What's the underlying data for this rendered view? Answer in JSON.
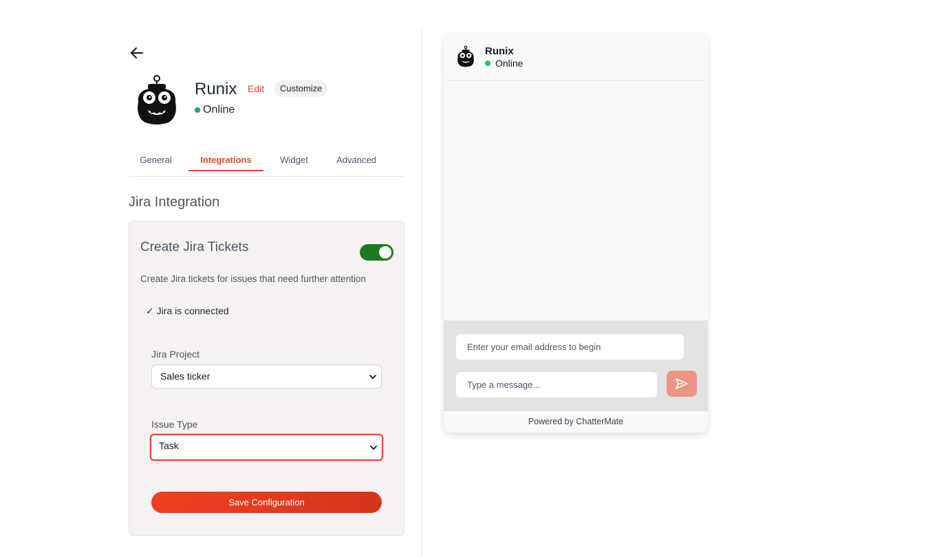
{
  "agent": {
    "name": "Runix",
    "edit_label": "Edit",
    "customize_label": "Customize",
    "status": "Online"
  },
  "tabs": [
    {
      "label": "General",
      "active": false
    },
    {
      "label": "Integrations",
      "active": true
    },
    {
      "label": "Widget",
      "active": false
    },
    {
      "label": "Advanced",
      "active": false
    }
  ],
  "section_title": "Jira Integration",
  "jira": {
    "card_title": "Create Jira Tickets",
    "toggle_on": true,
    "description": "Create Jira tickets for issues that need further attention",
    "connected_text": "✓ Jira is connected",
    "project_label": "Jira Project",
    "project_value": "Sales ticker",
    "issue_type_label": "Issue Type",
    "issue_type_value": "Task",
    "save_label": "Save Configuration"
  },
  "preview": {
    "name": "Runix",
    "status": "Online",
    "email_placeholder": "Enter your email address to begin",
    "message_placeholder": "Type a message...",
    "footer": "Powered by ChatterMate"
  },
  "colors": {
    "accent": "#e8472a",
    "toggle_on": "#1e7a1e",
    "online": "#22a06b",
    "send_button": "#ec9585"
  },
  "icons": {
    "back": "arrow-left-icon",
    "avatar": "robot-avatar-icon",
    "send": "send-icon",
    "chevron": "chevron-down-icon"
  }
}
